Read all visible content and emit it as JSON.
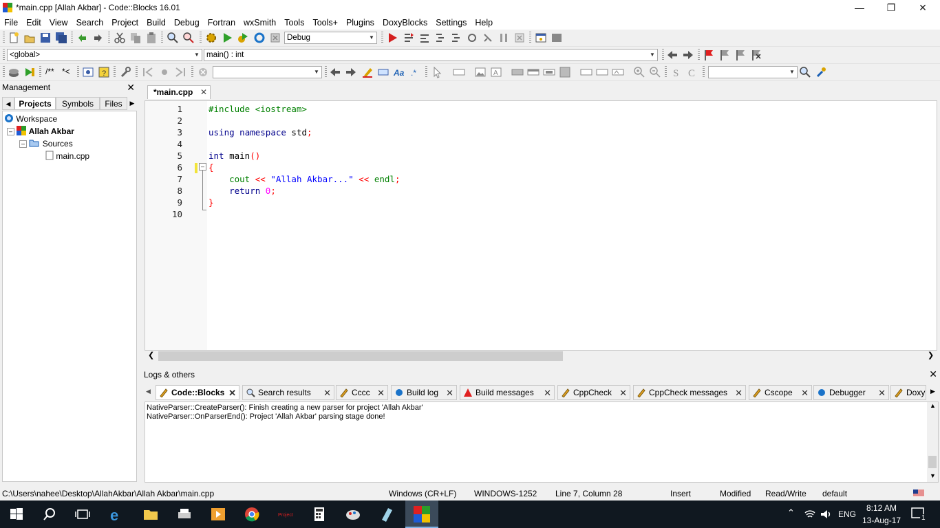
{
  "window": {
    "title": "*main.cpp [Allah Akbar] - Code::Blocks 16.01"
  },
  "menu": [
    "File",
    "Edit",
    "View",
    "Search",
    "Project",
    "Build",
    "Debug",
    "Fortran",
    "wxSmith",
    "Tools",
    "Tools+",
    "Plugins",
    "DoxyBlocks",
    "Settings",
    "Help"
  ],
  "toolbar": {
    "build_target": "Debug",
    "scope": "<global>",
    "function": "main() : int",
    "doc_comment_1": "/**",
    "doc_comment_2": "*<",
    "search_combo": ""
  },
  "management": {
    "title": "Management",
    "tabs": [
      "Projects",
      "Symbols",
      "Files"
    ],
    "tree": {
      "workspace": "Workspace",
      "project": "Allah Akbar",
      "folder": "Sources",
      "file": "main.cpp"
    }
  },
  "editor": {
    "tab": "*main.cpp",
    "line_numbers": [
      "1",
      "2",
      "3",
      "4",
      "5",
      "6",
      "7",
      "8",
      "9",
      "10"
    ],
    "lines": [
      [
        {
          "t": "#include <iostream>",
          "c": "#008000"
        }
      ],
      [],
      [
        {
          "t": "using",
          "c": "#00008b"
        },
        {
          "t": " ",
          "c": "#000"
        },
        {
          "t": "namespace",
          "c": "#00008b"
        },
        {
          "t": " std",
          "c": "#000"
        },
        {
          "t": ";",
          "c": "#ff0000"
        }
      ],
      [],
      [
        {
          "t": "int",
          "c": "#00008b"
        },
        {
          "t": " main",
          "c": "#000"
        },
        {
          "t": "()",
          "c": "#ff0000"
        }
      ],
      [
        {
          "t": "{",
          "c": "#ff0000"
        }
      ],
      [
        {
          "t": "    cout",
          "c": "#008000"
        },
        {
          "t": " << ",
          "c": "#ff0000"
        },
        {
          "t": "\"Allah Akbar...\"",
          "c": "#0000ff"
        },
        {
          "t": " << ",
          "c": "#ff0000"
        },
        {
          "t": "endl",
          "c": "#008000"
        },
        {
          "t": ";",
          "c": "#ff0000"
        }
      ],
      [
        {
          "t": "    return",
          "c": "#00008b"
        },
        {
          "t": " ",
          "c": "#000"
        },
        {
          "t": "0",
          "c": "#ff00ff"
        },
        {
          "t": ";",
          "c": "#ff0000"
        }
      ],
      [
        {
          "t": "}",
          "c": "#ff0000"
        }
      ],
      []
    ]
  },
  "logs": {
    "title": "Logs & others",
    "tabs": [
      "Code::Blocks",
      "Search results",
      "Cccc",
      "Build log",
      "Build messages",
      "CppCheck",
      "CppCheck messages",
      "Cscope",
      "Debugger",
      "DoxyB"
    ],
    "lines": [
      "NativeParser::CreateParser(): Finish creating a new parser for project 'Allah Akbar'",
      "NativeParser::OnParserEnd(): Project 'Allah Akbar' parsing stage done!"
    ]
  },
  "status": {
    "path": "C:\\Users\\nahee\\Desktop\\AllahAkbar\\Allah Akbar\\main.cpp",
    "eol": "Windows (CR+LF)",
    "encoding": "WINDOWS-1252",
    "position": "Line 7, Column 28",
    "mode": "Insert",
    "modified": "Modified",
    "access": "Read/Write",
    "profile": "default"
  },
  "taskbar": {
    "lang": "ENG",
    "time": "8:12 AM",
    "date": "13-Aug-17",
    "notifications": "1"
  }
}
